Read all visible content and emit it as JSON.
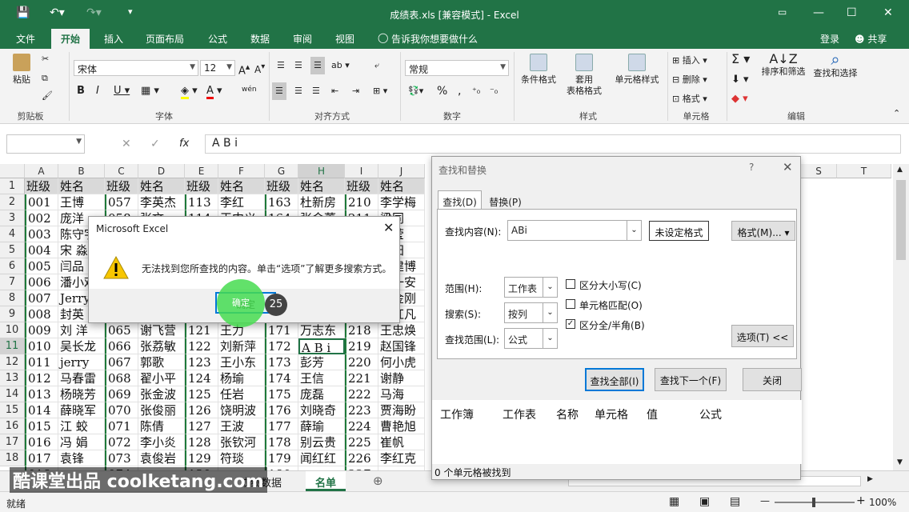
{
  "window": {
    "title": "成绩表.xls  [兼容模式] - Excel"
  },
  "tabs": {
    "file": "文件",
    "home": "开始",
    "insert": "插入",
    "layout": "页面布局",
    "formula": "公式",
    "data": "数据",
    "review": "审阅",
    "view": "视图",
    "tell": "告诉我你想要做什么",
    "login": "登录",
    "share": "共享"
  },
  "ribbon": {
    "paste": "粘贴",
    "clipboard": "剪贴板",
    "font_name": "宋体",
    "font_size": "12",
    "font_group": "字体",
    "align_group": "对齐方式",
    "number_format": "常规",
    "number_group": "数字",
    "cond_format": "条件格式",
    "table_format": "套用\n表格格式",
    "cell_style": "单元格样式",
    "styles_group": "样式",
    "insert": "插入",
    "delete": "删除",
    "format": "格式",
    "cells_group": "单元格",
    "sort": "排序和筛选",
    "findsel": "查找和选择",
    "edit_group": "编辑",
    "wen": "wén"
  },
  "formula_bar": {
    "name_box": "",
    "value": "A B i",
    "fx": "fx"
  },
  "sheet": {
    "cols": [
      "A",
      "B",
      "C",
      "D",
      "E",
      "F",
      "G",
      "H",
      "I",
      "J"
    ],
    "rows": [
      [
        "班级",
        "姓名",
        "班级",
        "姓名",
        "班级",
        "姓名",
        "班级",
        "姓名",
        "班级",
        "姓名"
      ],
      [
        "001",
        "王博",
        "057",
        "李英杰",
        "113",
        "李红",
        "163",
        "杜新房",
        "210",
        "李学梅"
      ],
      [
        "002",
        "庞洋",
        "058",
        "张文",
        "114",
        "王中义",
        "164",
        "张金蕾",
        "211",
        "梁同"
      ],
      [
        "003",
        "陈守宇",
        "059",
        "",
        "115",
        "",
        "165",
        "",
        "212",
        "王莹"
      ],
      [
        "004",
        "宋  淼",
        "060",
        "",
        "116",
        "",
        "166",
        "",
        "213",
        "韩阳"
      ],
      [
        "005",
        "闫品",
        "061",
        "",
        "117",
        "",
        "167",
        "",
        "214",
        "陈建博"
      ],
      [
        "006",
        "潘小欢",
        "062",
        "",
        "118",
        "",
        "168",
        "",
        "215",
        "王一安"
      ],
      [
        "007",
        "Jerry",
        "063",
        "",
        "119",
        "",
        "169",
        "",
        "216",
        "胡金刚"
      ],
      [
        "008",
        "封英",
        "064",
        "",
        "120",
        "",
        "170",
        "",
        "217",
        "吕红凡"
      ],
      [
        "009",
        "刘  洋",
        "065",
        "谢飞营",
        "121",
        "王力",
        "171",
        "万志东",
        "218",
        "王忠焕"
      ],
      [
        "010",
        "吴长龙",
        "066",
        "张荔敏",
        "122",
        "刘新萍",
        "172",
        "A B i",
        "219",
        "赵国锋"
      ],
      [
        "011",
        "jerry",
        "067",
        "郭歌",
        "123",
        "王小东",
        "173",
        "彭芳",
        "220",
        "何小虎"
      ],
      [
        "012",
        "马春雷",
        "068",
        "翟小平",
        "124",
        "杨瑜",
        "174",
        "王信",
        "221",
        "谢静"
      ],
      [
        "013",
        "杨晓芳",
        "069",
        "张金波",
        "125",
        "任岩",
        "175",
        "庞磊",
        "222",
        "马海"
      ],
      [
        "014",
        "薛晓军",
        "070",
        "张俊丽",
        "126",
        "饶明波",
        "176",
        "刘晓奇",
        "223",
        "贾海盼"
      ],
      [
        "015",
        "江  蛟",
        "071",
        "陈倩",
        "127",
        "王波",
        "177",
        "薛瑜",
        "224",
        "曹艳旭"
      ],
      [
        "016",
        "冯  娟",
        "072",
        "李小炎",
        "128",
        "张钦河",
        "178",
        "别云贵",
        "225",
        "崔帆"
      ],
      [
        "017",
        "袁锋",
        "073",
        "袁俊岩",
        "129",
        "符琰",
        "179",
        "闻红红",
        "226",
        "李红克"
      ],
      [
        "018",
        "",
        "074",
        "",
        "130",
        "",
        "180",
        "",
        "227",
        ""
      ]
    ],
    "row_nums": [
      "1",
      "2",
      "3",
      "4",
      "5",
      "6",
      "7",
      "8",
      "9",
      "10",
      "11",
      "12",
      "13",
      "14",
      "15",
      "16",
      "17",
      "18"
    ],
    "extra_cols": [
      "S",
      "T"
    ],
    "sheet_tab_prev": "成绩数据",
    "sheet_tab_active": "名单"
  },
  "status": {
    "ready": "就绪",
    "zoom": "100%"
  },
  "find_dialog": {
    "title": "查找和替换",
    "help": "?",
    "tab_find": "查找(D)",
    "tab_replace": "替换(P)",
    "find_label": "查找内容(N):",
    "find_value": "ABi",
    "noformat": "未设定格式",
    "format_btn": "格式(M)...",
    "scope_label": "范围(H):",
    "scope_value": "工作表",
    "search_label": "搜索(S):",
    "search_value": "按列",
    "lookin_label": "查找范围(L):",
    "lookin_value": "公式",
    "case": "区分大小写(C)",
    "whole": "单元格匹配(O)",
    "width": "区分全/半角(B)",
    "options": "选项(T) <<",
    "find_all": "查找全部(I)",
    "find_next": "查找下一个(F)",
    "close": "关闭",
    "cols": [
      "工作簿",
      "工作表",
      "名称",
      "单元格",
      "值",
      "公式"
    ],
    "result": "0 个单元格被找到"
  },
  "msg_dialog": {
    "title": "Microsoft Excel",
    "text": "无法找到您所查找的内容。单击“选项”了解更多搜索方式。",
    "ok": "确定",
    "step": "25"
  },
  "watermark": "酷课堂出品 coolketang.com",
  "colors": {
    "excel_green": "#217346",
    "dialog_bg": "#f0f0f0"
  }
}
